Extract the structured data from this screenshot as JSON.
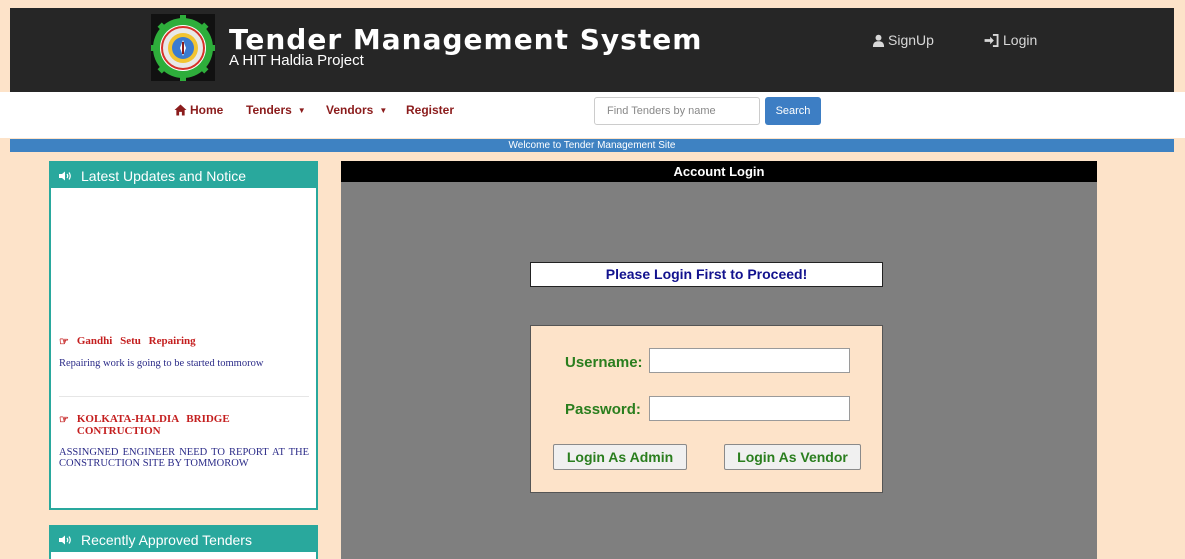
{
  "header": {
    "title": "Tender Management System",
    "subtitle": "A HIT Haldia Project",
    "signup_label": "SignUp",
    "login_label": "Login"
  },
  "nav": {
    "home": "Home",
    "tenders": "Tenders",
    "vendors": "Vendors",
    "register": "Register",
    "search_placeholder": "Find Tenders by name",
    "search_button": "Search"
  },
  "welcome": "Welcome to Tender Management Site",
  "sidebar": {
    "updates_title": "Latest Updates and Notice",
    "notices": [
      {
        "title": "Gandhi Setu Repairing",
        "text": "Repairing work is going to be started tommorow"
      },
      {
        "title": "KOLKATA-HALDIA BRIDGE CONTRUCTION",
        "text": "ASSINGNED ENGINEER NEED TO REPORT AT THE CONSTRUCTION SITE BY TOMMOROW"
      }
    ],
    "approved_title": "Recently Approved Tenders"
  },
  "login": {
    "header": "Account Login",
    "notice": "Please Login First to Proceed!",
    "username_label": "Username:",
    "password_label": "Password:",
    "username_value": "",
    "password_value": "",
    "admin_button": "Login As Admin",
    "vendor_button": "Login As Vendor"
  },
  "colors": {
    "top_bar": "#262626",
    "page_bg": "#fde3c9",
    "welcome_bar": "#3e82c2",
    "panel_teal": "#29a89d",
    "nav_text": "#8b1c1c",
    "login_green": "#2a7e1e",
    "main_gray": "#7f7f7f"
  }
}
